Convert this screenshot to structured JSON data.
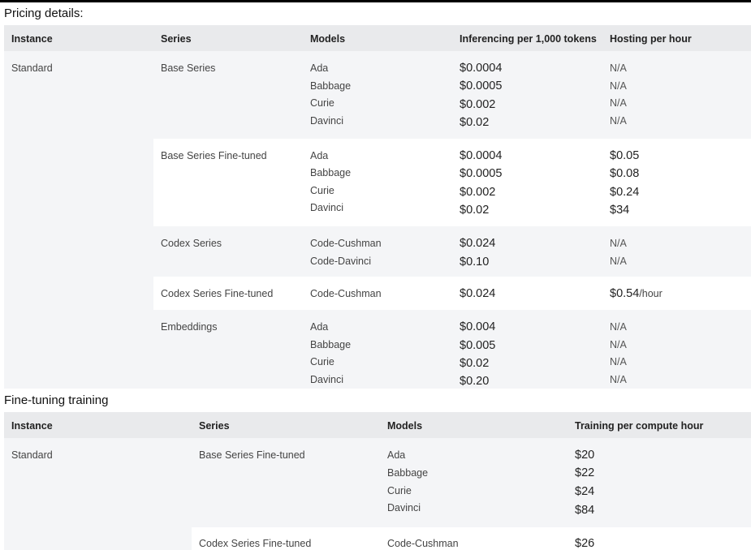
{
  "pricing": {
    "title": "Pricing details:",
    "headers": [
      "Instance",
      "Series",
      "Models",
      "Inferencing per 1,000 tokens",
      "Hosting per hour"
    ],
    "instance": "Standard",
    "groups": [
      {
        "series": "Base Series",
        "rows": [
          {
            "model": "Ada",
            "inference": "$0.0004",
            "hosting": "N/A"
          },
          {
            "model": "Babbage",
            "inference": "$0.0005",
            "hosting": "N/A"
          },
          {
            "model": "Curie",
            "inference": "$0.002",
            "hosting": "N/A"
          },
          {
            "model": "Davinci",
            "inference": "$0.02",
            "hosting": "N/A"
          }
        ]
      },
      {
        "series": "Base Series Fine-tuned",
        "rows": [
          {
            "model": "Ada",
            "inference": "$0.0004",
            "hosting": "$0.05"
          },
          {
            "model": "Babbage",
            "inference": "$0.0005",
            "hosting": "$0.08"
          },
          {
            "model": "Curie",
            "inference": "$0.002",
            "hosting": "$0.24"
          },
          {
            "model": "Davinci",
            "inference": "$0.02",
            "hosting": "$34"
          }
        ]
      },
      {
        "series": "Codex Series",
        "rows": [
          {
            "model": "Code-Cushman",
            "inference": "$0.024",
            "hosting": "N/A"
          },
          {
            "model": "Code-Davinci",
            "inference": "$0.10",
            "hosting": "N/A"
          }
        ]
      },
      {
        "series": "Codex Series Fine-tuned",
        "rows": [
          {
            "model": "Code-Cushman",
            "inference": "$0.024",
            "hosting": "$0.54",
            "hosting_unit": "/hour"
          }
        ]
      },
      {
        "series": "Embeddings",
        "rows": [
          {
            "model": "Ada",
            "inference": "$0.004",
            "hosting": "N/A"
          },
          {
            "model": "Babbage",
            "inference": "$0.005",
            "hosting": "N/A"
          },
          {
            "model": "Curie",
            "inference": "$0.02",
            "hosting": "N/A"
          },
          {
            "model": "Davinci",
            "inference": "$0.20",
            "hosting": "N/A"
          }
        ]
      }
    ]
  },
  "training": {
    "title": "Fine-tuning training",
    "headers": [
      "Instance",
      "Series",
      "Models",
      "Training per compute hour"
    ],
    "instance": "Standard",
    "groups": [
      {
        "series": "Base Series Fine-tuned",
        "rows": [
          {
            "model": "Ada",
            "price": "$20"
          },
          {
            "model": "Babbage",
            "price": "$22"
          },
          {
            "model": "Curie",
            "price": "$24"
          },
          {
            "model": "Davinci",
            "price": "$84"
          }
        ]
      },
      {
        "series": "Codex Series Fine-tuned",
        "rows": [
          {
            "model": "Code-Cushman",
            "price": "$26"
          }
        ]
      }
    ]
  }
}
